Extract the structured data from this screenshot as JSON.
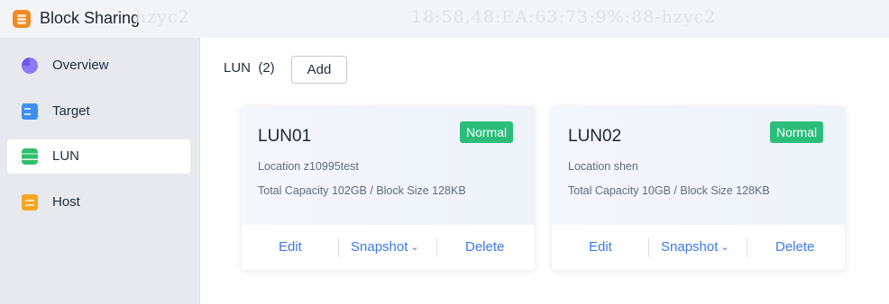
{
  "app": {
    "title": "Block Sharing",
    "watermark_left": "hzyc2",
    "watermark_right": "18:58,48:EA:63:73:9%:88-hzyc2"
  },
  "sidebar": {
    "items": [
      {
        "label": "Overview",
        "icon": "overview-pie-icon"
      },
      {
        "label": "Target",
        "icon": "target-icon"
      },
      {
        "label": "LUN",
        "icon": "lun-database-icon",
        "active": true
      },
      {
        "label": "Host",
        "icon": "host-icon"
      }
    ]
  },
  "main": {
    "lun_count_label": "LUN  (2)",
    "add_label": "Add",
    "cards": [
      {
        "name": "LUN01",
        "status": "Normal",
        "location": "Location z10995test",
        "capacity": "Total Capacity 102GB / Block Size 128KB",
        "edit": "Edit",
        "snapshot": "Snapshot",
        "delete": "Delete"
      },
      {
        "name": "LUN02",
        "status": "Normal",
        "location": "Location shen",
        "capacity": "Total Capacity 10GB / Block Size 128KB",
        "edit": "Edit",
        "snapshot": "Snapshot",
        "delete": "Delete"
      }
    ]
  },
  "colors": {
    "accent": "#3a7be8",
    "status_normal": "#2dbd7a",
    "app_icon": "#f08a24"
  }
}
